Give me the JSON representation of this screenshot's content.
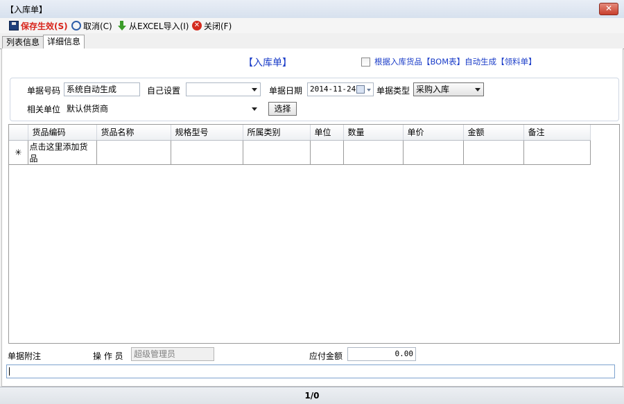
{
  "window": {
    "title": "【入库单】",
    "close_symbol": "✕"
  },
  "toolbar": {
    "save_label": "保存生效(S)",
    "cancel_label": "取消(C)",
    "import_label": "从EXCEL导入(I)",
    "close_label": "关闭(F)",
    "save_color": "#d8231a"
  },
  "tabs": [
    {
      "label": "列表信息",
      "active": false
    },
    {
      "label": "详细信息",
      "active": true
    }
  ],
  "form": {
    "title": "【入库单】",
    "bom_option_label": "根据入库货品【BOM表】自动生成【领料单】",
    "doc_no_label": "单据号码",
    "doc_no_value": "系统自动生成",
    "custom_label": "自己设置",
    "custom_value": "",
    "date_label": "单据日期",
    "date_value": "2014-11-24",
    "type_label": "单据类型",
    "type_value": "采购入库",
    "partner_label": "相关单位",
    "partner_value": "默认供货商",
    "select_button": "选择"
  },
  "grid": {
    "columns": [
      "货品编码",
      "货品名称",
      "规格型号",
      "所属类别",
      "单位",
      "数量",
      "单价",
      "金额",
      "备注"
    ],
    "new_row_marker": "✳",
    "new_row_hint": "点击这里添加货品"
  },
  "footer": {
    "remark_label": "单据附注",
    "operator_label": "操 作 员",
    "operator_value": "超级管理员",
    "payable_label": "应付金额",
    "payable_value": "0.00",
    "remark_value": ""
  },
  "status": {
    "page": "1/0"
  }
}
